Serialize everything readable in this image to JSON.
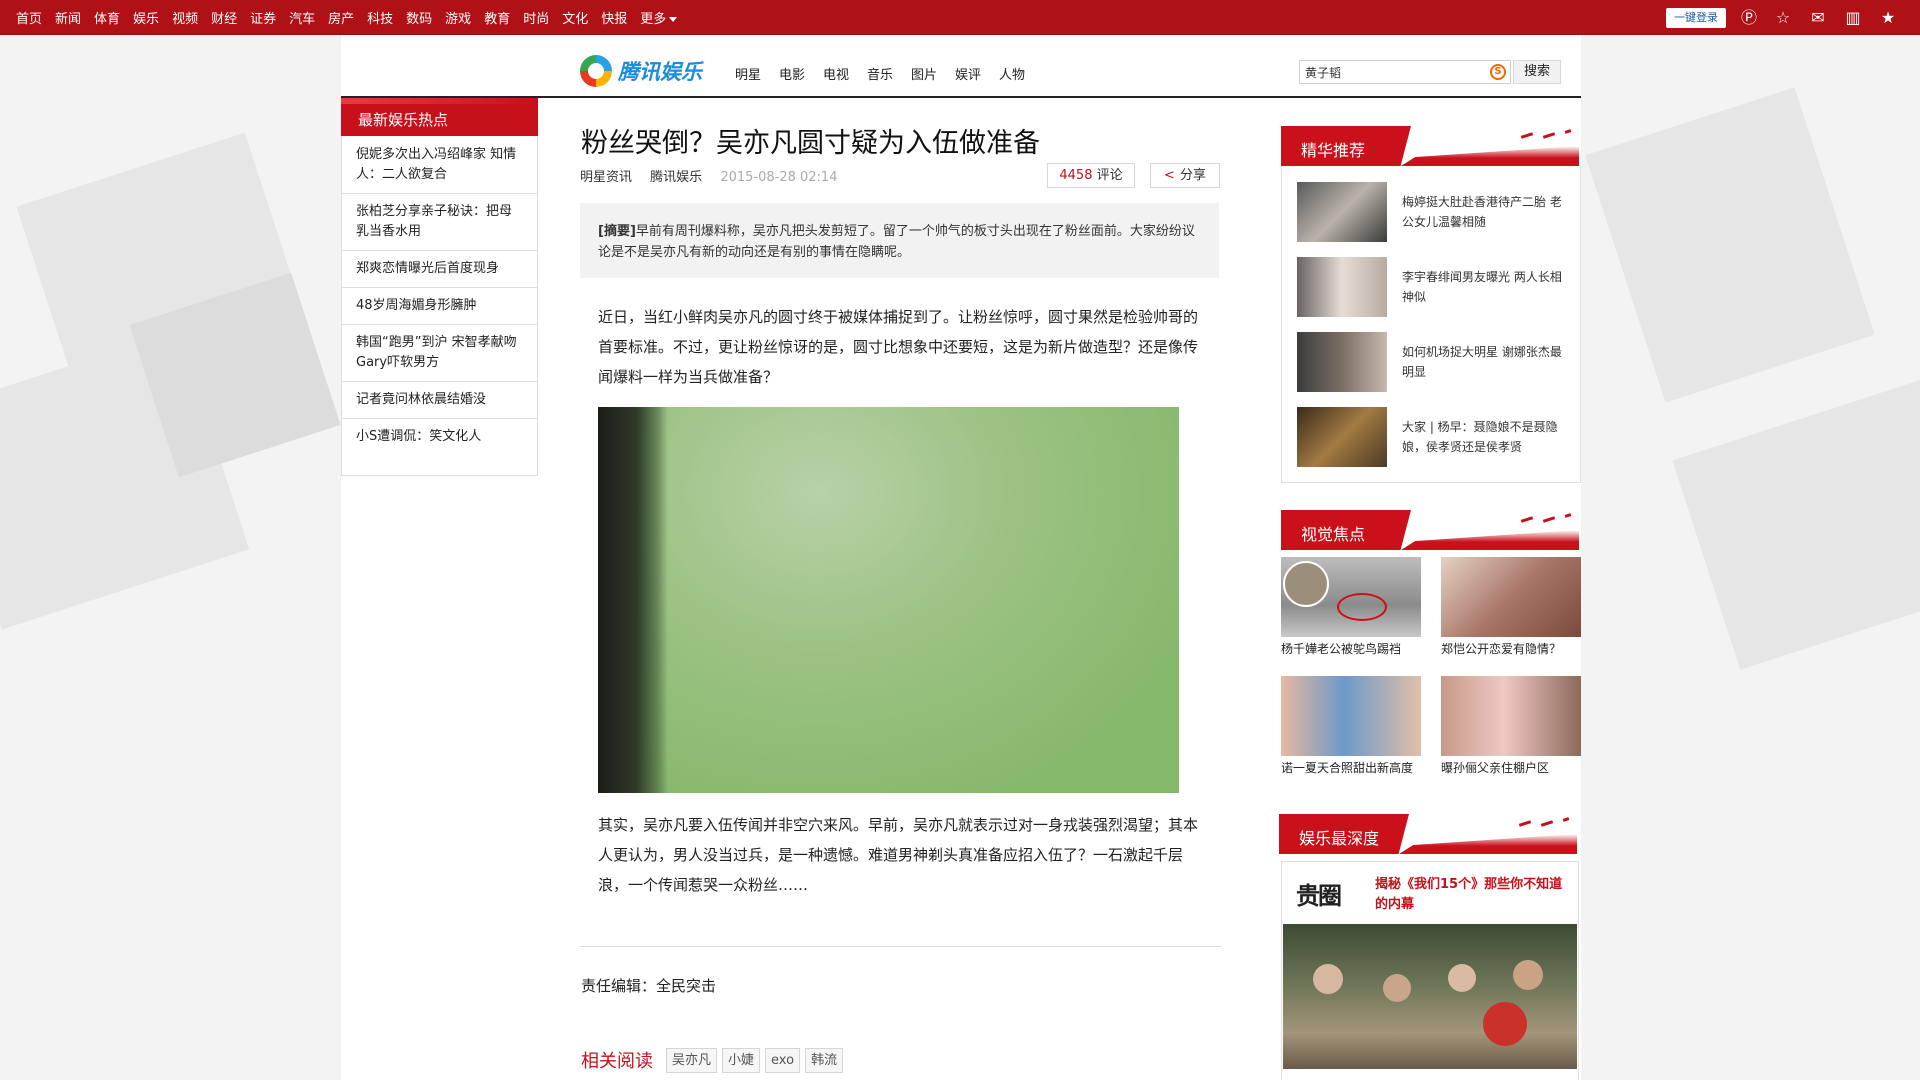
{
  "topnav": {
    "links": [
      "首页",
      "新闻",
      "体育",
      "娱乐",
      "视频",
      "财经",
      "证券",
      "汽车",
      "房产",
      "科技",
      "数码",
      "游戏",
      "教育",
      "时尚",
      "文化",
      "快报"
    ],
    "more": "更多",
    "login": "一键登录",
    "icons": [
      "p-icon",
      "star-outline-icon",
      "mail-icon",
      "book-icon",
      "star-icon"
    ]
  },
  "header": {
    "logo_text": "腾讯娱乐",
    "channels": [
      "明星",
      "电影",
      "电视",
      "音乐",
      "图片",
      "娱评",
      "人物"
    ],
    "search_value": "黄子韬",
    "search_button": "搜索"
  },
  "left_hot": {
    "title": "最新娱乐热点",
    "items": [
      "倪妮多次出入冯绍峰家 知情人：二人欲复合",
      "张柏芝分享亲子秘诀：把母乳当香水用",
      "郑爽恋情曝光后首度现身",
      "48岁周海媚身形臃肿",
      "韩国“跑男”到沪 宋智孝献吻Gary吓软男方",
      "记者竟问林依晨结婚没",
      "小S遭调侃：笑文化人"
    ]
  },
  "article": {
    "title": "粉丝哭倒？吴亦凡圆寸疑为入伍做准备",
    "source": "明星资讯",
    "site": "腾讯娱乐",
    "time": "2015-08-28 02:14",
    "comment_count": "4458",
    "comment_label": "评论",
    "share_label": "分享",
    "summary_tag": "[摘要]",
    "summary": "早前有周刊爆料称，吴亦凡把头发剪短了。留了一个帅气的板寸头出现在了粉丝面前。大家纷纷议论是不是吴亦凡有新的动向还是有别的事情在隐瞒呢。",
    "para1": "近日，当红小鲜肉吴亦凡的圆寸终于被媒体捕捉到了。让粉丝惊呼，圆寸果然是检验帅哥的首要标准。不过，更让粉丝惊讶的是，圆寸比想象中还要短，这是为新片做造型？还是像传闻爆料一样为当兵做准备？",
    "para2": "其实，吴亦凡要入伍传闻并非空穴来风。早前，吴亦凡就表示过对一身戎装强烈渴望；其本人更认为，男人没当过兵，是一种遗憾。难道男神剃头真准备应招入伍了？一石激起千层浪，一个传闻惹哭一众粉丝……",
    "editor": "责任编辑：全民突击",
    "related_title": "相关阅读",
    "tags": [
      "吴亦凡",
      "小婕",
      "exo",
      "韩流"
    ]
  },
  "sidebar": {
    "featured": {
      "title": "精华推荐",
      "items": [
        "梅婷挺大肚赴香港待产二胎 老公女儿温馨相随",
        "李宇春绯闻男友曝光 两人长相神似",
        "如何机场捉大明星 谢娜张杰最明显",
        "大家 | 杨早：聂隐娘不是聂隐娘，侯孝贤还是侯孝贤"
      ]
    },
    "visual": {
      "title": "视觉焦点",
      "items": [
        "杨千嬅老公被鸵鸟踢裆",
        "郑恺公开恋爱有隐情？",
        "诺一夏天合照甜出新高度",
        "曝孙俪父亲住棚户区"
      ]
    },
    "deep": {
      "title": "娱乐最深度",
      "logo": "贵圈",
      "headline": "揭秘《我们15个》那些你不知道的内幕"
    }
  }
}
